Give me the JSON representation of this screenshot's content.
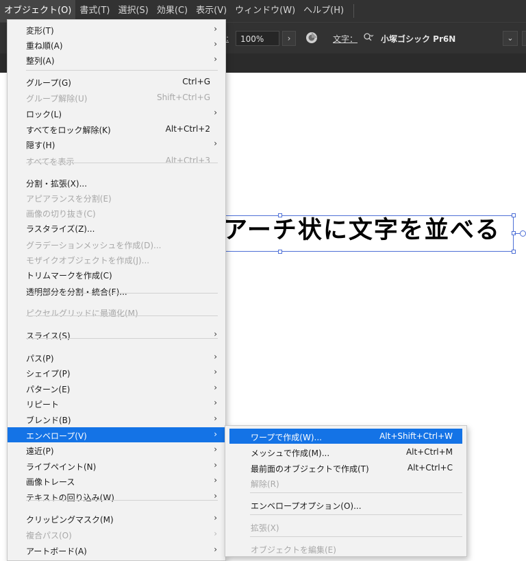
{
  "menubar": {
    "items": [
      "オブジェクト(O)",
      "書式(T)",
      "選択(S)",
      "効果(C)",
      "表示(V)",
      "ウィンドウ(W)",
      "ヘルプ(H)"
    ]
  },
  "controlbar": {
    "zoom_label": ":",
    "zoom_value": "100%",
    "zoom_arrow": "›",
    "font_label": "文字：",
    "font_search_icon": "search-dropdown-icon",
    "font_name": "小塚ゴシック Pr6N",
    "font_dropdown": "⌄"
  },
  "canvas": {
    "text": "アーチ状に文字を並べる"
  },
  "main_menu": {
    "items": [
      {
        "label": "変形(T)",
        "shortcut": "",
        "submenu": true,
        "disabled": false
      },
      {
        "label": "重ね順(A)",
        "shortcut": "",
        "submenu": true,
        "disabled": false
      },
      {
        "label": "整列(A)",
        "shortcut": "",
        "submenu": true,
        "disabled": false
      },
      {
        "label": "グループ(G)",
        "shortcut": "Ctrl+G",
        "submenu": false,
        "disabled": false
      },
      {
        "label": "グループ解除(U)",
        "shortcut": "Shift+Ctrl+G",
        "submenu": false,
        "disabled": true
      },
      {
        "label": "ロック(L)",
        "shortcut": "",
        "submenu": true,
        "disabled": false
      },
      {
        "label": "すべてをロック解除(K)",
        "shortcut": "Alt+Ctrl+2",
        "submenu": false,
        "disabled": false
      },
      {
        "label": "隠す(H)",
        "shortcut": "",
        "submenu": true,
        "disabled": false
      },
      {
        "label": "すべてを表示",
        "shortcut": "Alt+Ctrl+3",
        "submenu": false,
        "disabled": true
      },
      {
        "label": "分割・拡張(X)...",
        "shortcut": "",
        "submenu": false,
        "disabled": false
      },
      {
        "label": "アピアランスを分割(E)",
        "shortcut": "",
        "submenu": false,
        "disabled": true
      },
      {
        "label": "画像の切り抜き(C)",
        "shortcut": "",
        "submenu": false,
        "disabled": true
      },
      {
        "label": "ラスタライズ(Z)...",
        "shortcut": "",
        "submenu": false,
        "disabled": false
      },
      {
        "label": "グラデーションメッシュを作成(D)...",
        "shortcut": "",
        "submenu": false,
        "disabled": true
      },
      {
        "label": "モザイクオブジェクトを作成(J)...",
        "shortcut": "",
        "submenu": false,
        "disabled": true
      },
      {
        "label": "トリムマークを作成(C)",
        "shortcut": "",
        "submenu": false,
        "disabled": false
      },
      {
        "label": "透明部分を分割・統合(F)...",
        "shortcut": "",
        "submenu": false,
        "disabled": false
      },
      {
        "label": "ピクセルグリッドに最適化(M)",
        "shortcut": "",
        "submenu": false,
        "disabled": true
      },
      {
        "label": "スライス(S)",
        "shortcut": "",
        "submenu": true,
        "disabled": false
      },
      {
        "label": "パス(P)",
        "shortcut": "",
        "submenu": true,
        "disabled": false
      },
      {
        "label": "シェイプ(P)",
        "shortcut": "",
        "submenu": true,
        "disabled": false
      },
      {
        "label": "パターン(E)",
        "shortcut": "",
        "submenu": true,
        "disabled": false
      },
      {
        "label": "リピート",
        "shortcut": "",
        "submenu": true,
        "disabled": false
      },
      {
        "label": "ブレンド(B)",
        "shortcut": "",
        "submenu": true,
        "disabled": false
      },
      {
        "label": "エンベロープ(V)",
        "shortcut": "",
        "submenu": true,
        "disabled": false
      },
      {
        "label": "遠近(P)",
        "shortcut": "",
        "submenu": true,
        "disabled": false
      },
      {
        "label": "ライブペイント(N)",
        "shortcut": "",
        "submenu": true,
        "disabled": false
      },
      {
        "label": "画像トレース",
        "shortcut": "",
        "submenu": true,
        "disabled": false
      },
      {
        "label": "テキストの回り込み(W)",
        "shortcut": "",
        "submenu": true,
        "disabled": false
      },
      {
        "label": "クリッピングマスク(M)",
        "shortcut": "",
        "submenu": true,
        "disabled": false
      },
      {
        "label": "複合パス(O)",
        "shortcut": "",
        "submenu": true,
        "disabled": true
      },
      {
        "label": "アートボード(A)",
        "shortcut": "",
        "submenu": true,
        "disabled": false
      }
    ]
  },
  "envelope_submenu": {
    "items": [
      {
        "label": "ワープで作成(W)...",
        "shortcut": "Alt+Shift+Ctrl+W",
        "disabled": false
      },
      {
        "label": "メッシュで作成(M)...",
        "shortcut": "Alt+Ctrl+M",
        "disabled": false
      },
      {
        "label": "最前面のオブジェクトで作成(T)",
        "shortcut": "Alt+Ctrl+C",
        "disabled": false
      },
      {
        "label": "解除(R)",
        "shortcut": "",
        "disabled": true
      },
      {
        "label": "エンベロープオプション(O)...",
        "shortcut": "",
        "disabled": false
      },
      {
        "label": "拡張(X)",
        "shortcut": "",
        "disabled": true
      },
      {
        "label": "オブジェクトを編集(E)",
        "shortcut": "",
        "disabled": true
      }
    ]
  },
  "colors": {
    "highlight": "#1473e6",
    "menubar_bg": "#323232",
    "menu_bg": "#f2f2f2",
    "selection": "#4d6fd6"
  }
}
